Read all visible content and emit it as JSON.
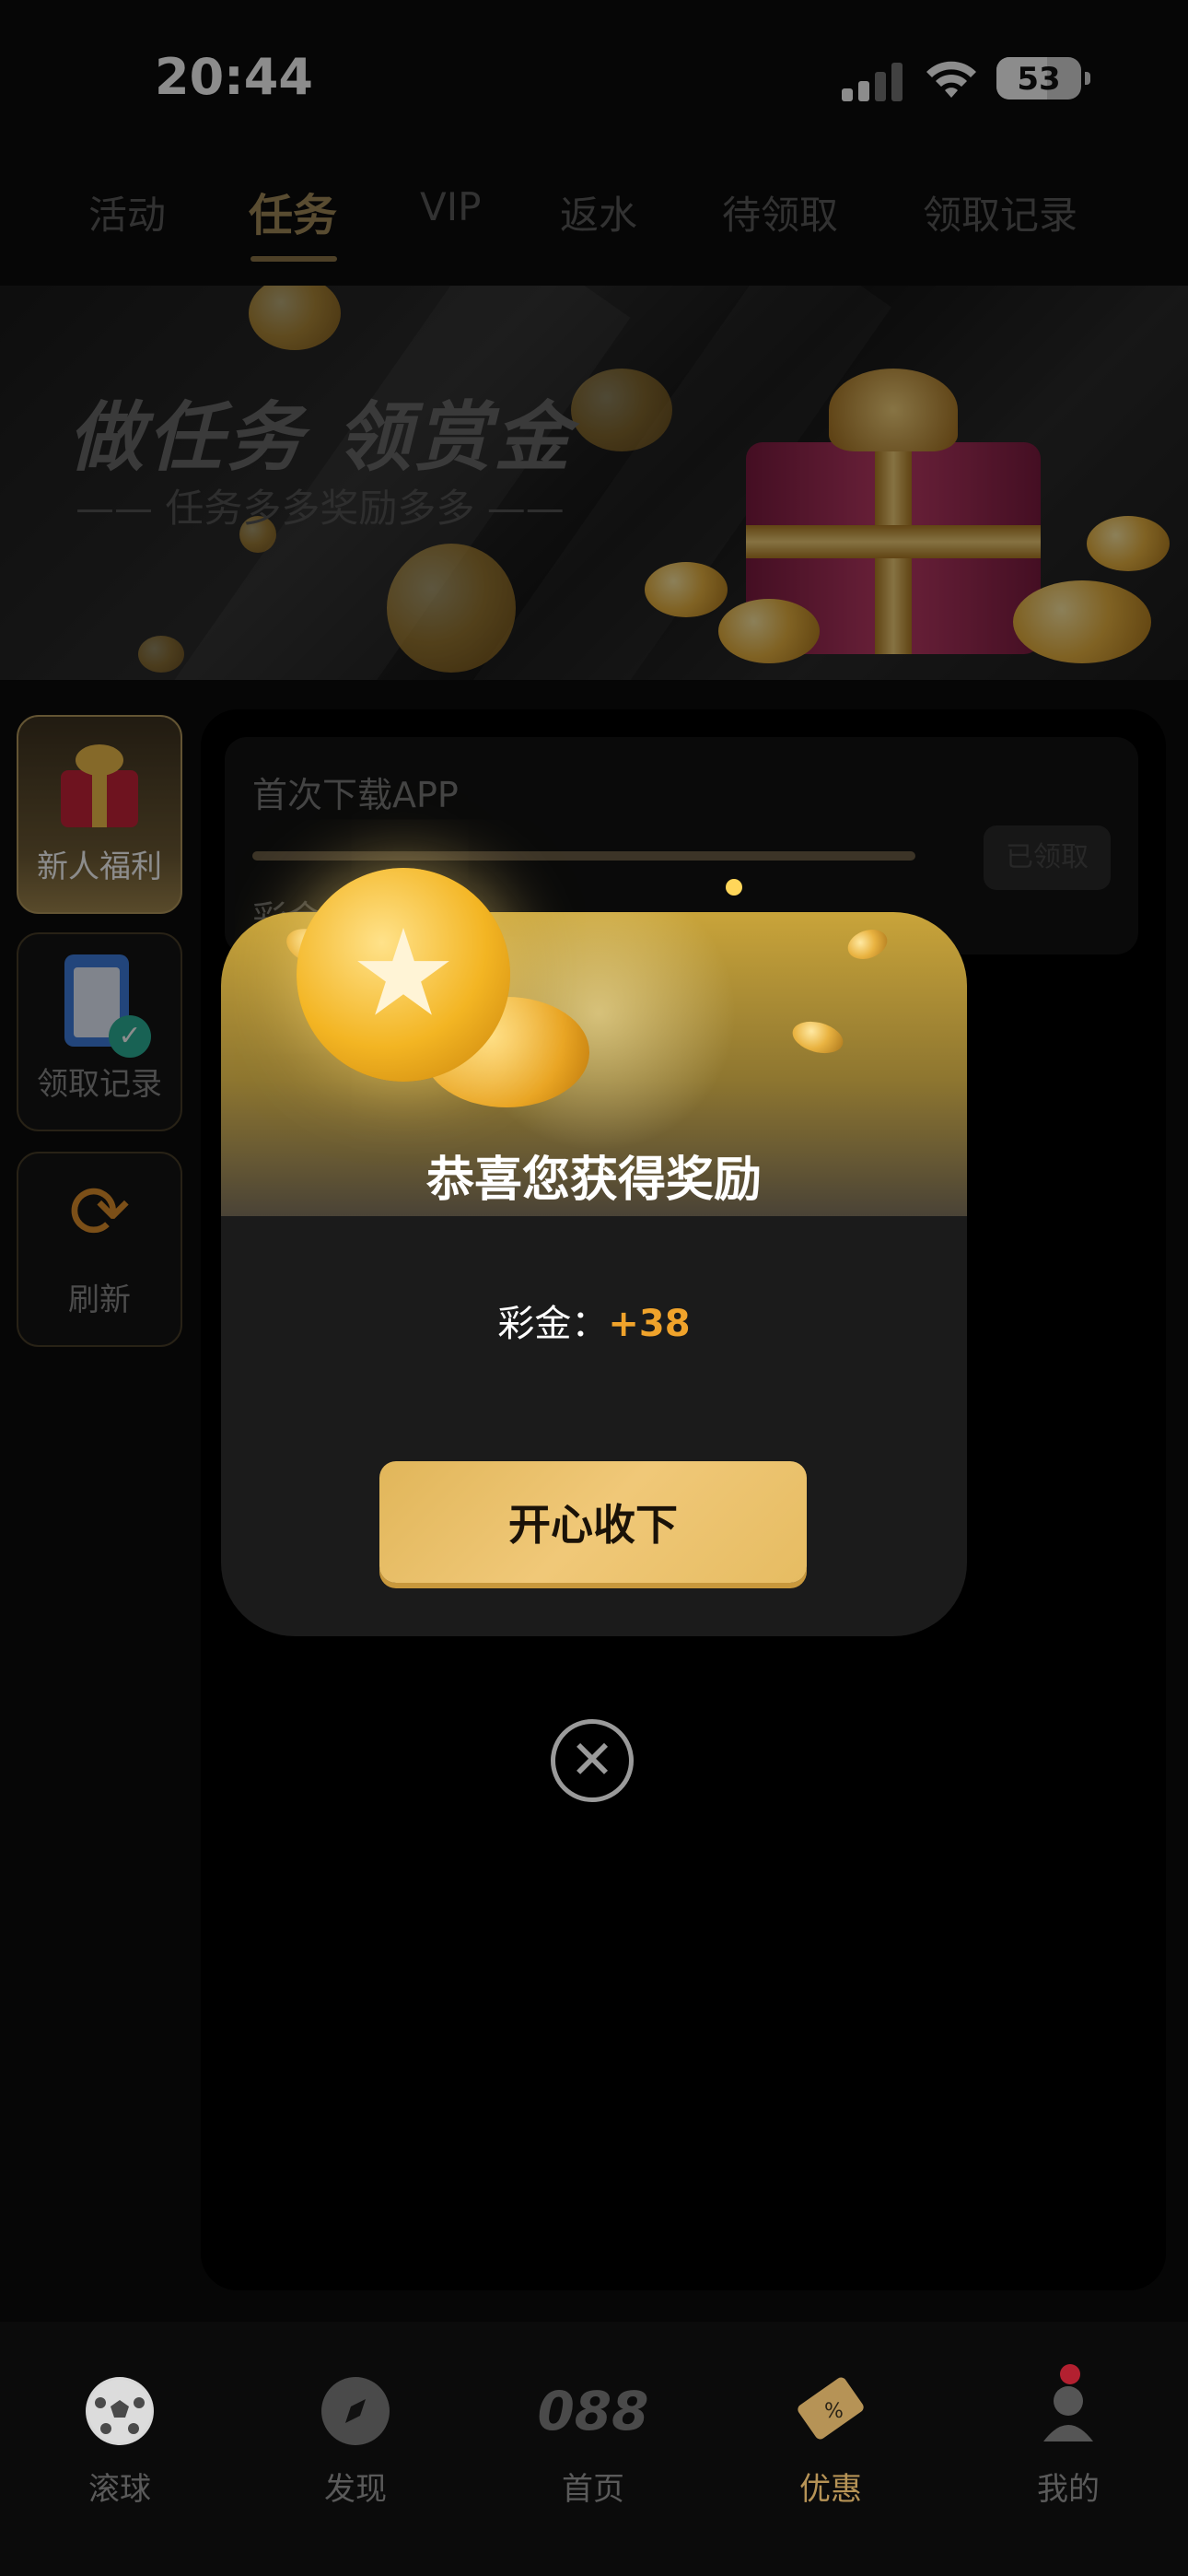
{
  "status_bar": {
    "time": "20:44",
    "battery": "53"
  },
  "tabs": [
    {
      "label": "活动"
    },
    {
      "label": "任务"
    },
    {
      "label": "VIP"
    },
    {
      "label": "返水"
    },
    {
      "label": "待领取"
    },
    {
      "label": "领取记录"
    }
  ],
  "banner": {
    "title": "做任务 领赏金",
    "subtitle": "—— 任务多多奖励多多 ——"
  },
  "sidebar": [
    {
      "label": "新人福利"
    },
    {
      "label": "领取记录"
    },
    {
      "label": "刷新"
    }
  ],
  "task": {
    "name": "首次下载APP",
    "reward": "彩金：+38",
    "button": "已领取",
    "progress": 1.0
  },
  "modal": {
    "title": "恭喜您获得奖励",
    "reward_label": "彩金：",
    "reward_value": "+38",
    "claim_button": "开心收下",
    "close_symbol": "✕"
  },
  "bottom_nav": [
    {
      "label": "滚球",
      "icon": "soccer-ball-icon"
    },
    {
      "label": "发现",
      "icon": "compass-icon"
    },
    {
      "label": "首页",
      "icon": "home-logo-icon",
      "logo_text": "088"
    },
    {
      "label": "优惠",
      "icon": "ticket-icon"
    },
    {
      "label": "我的",
      "icon": "user-icon"
    }
  ],
  "colors": {
    "accent_gold": "#b69356",
    "reward_orange": "#f0a32b",
    "background": "#0b0b0b"
  }
}
